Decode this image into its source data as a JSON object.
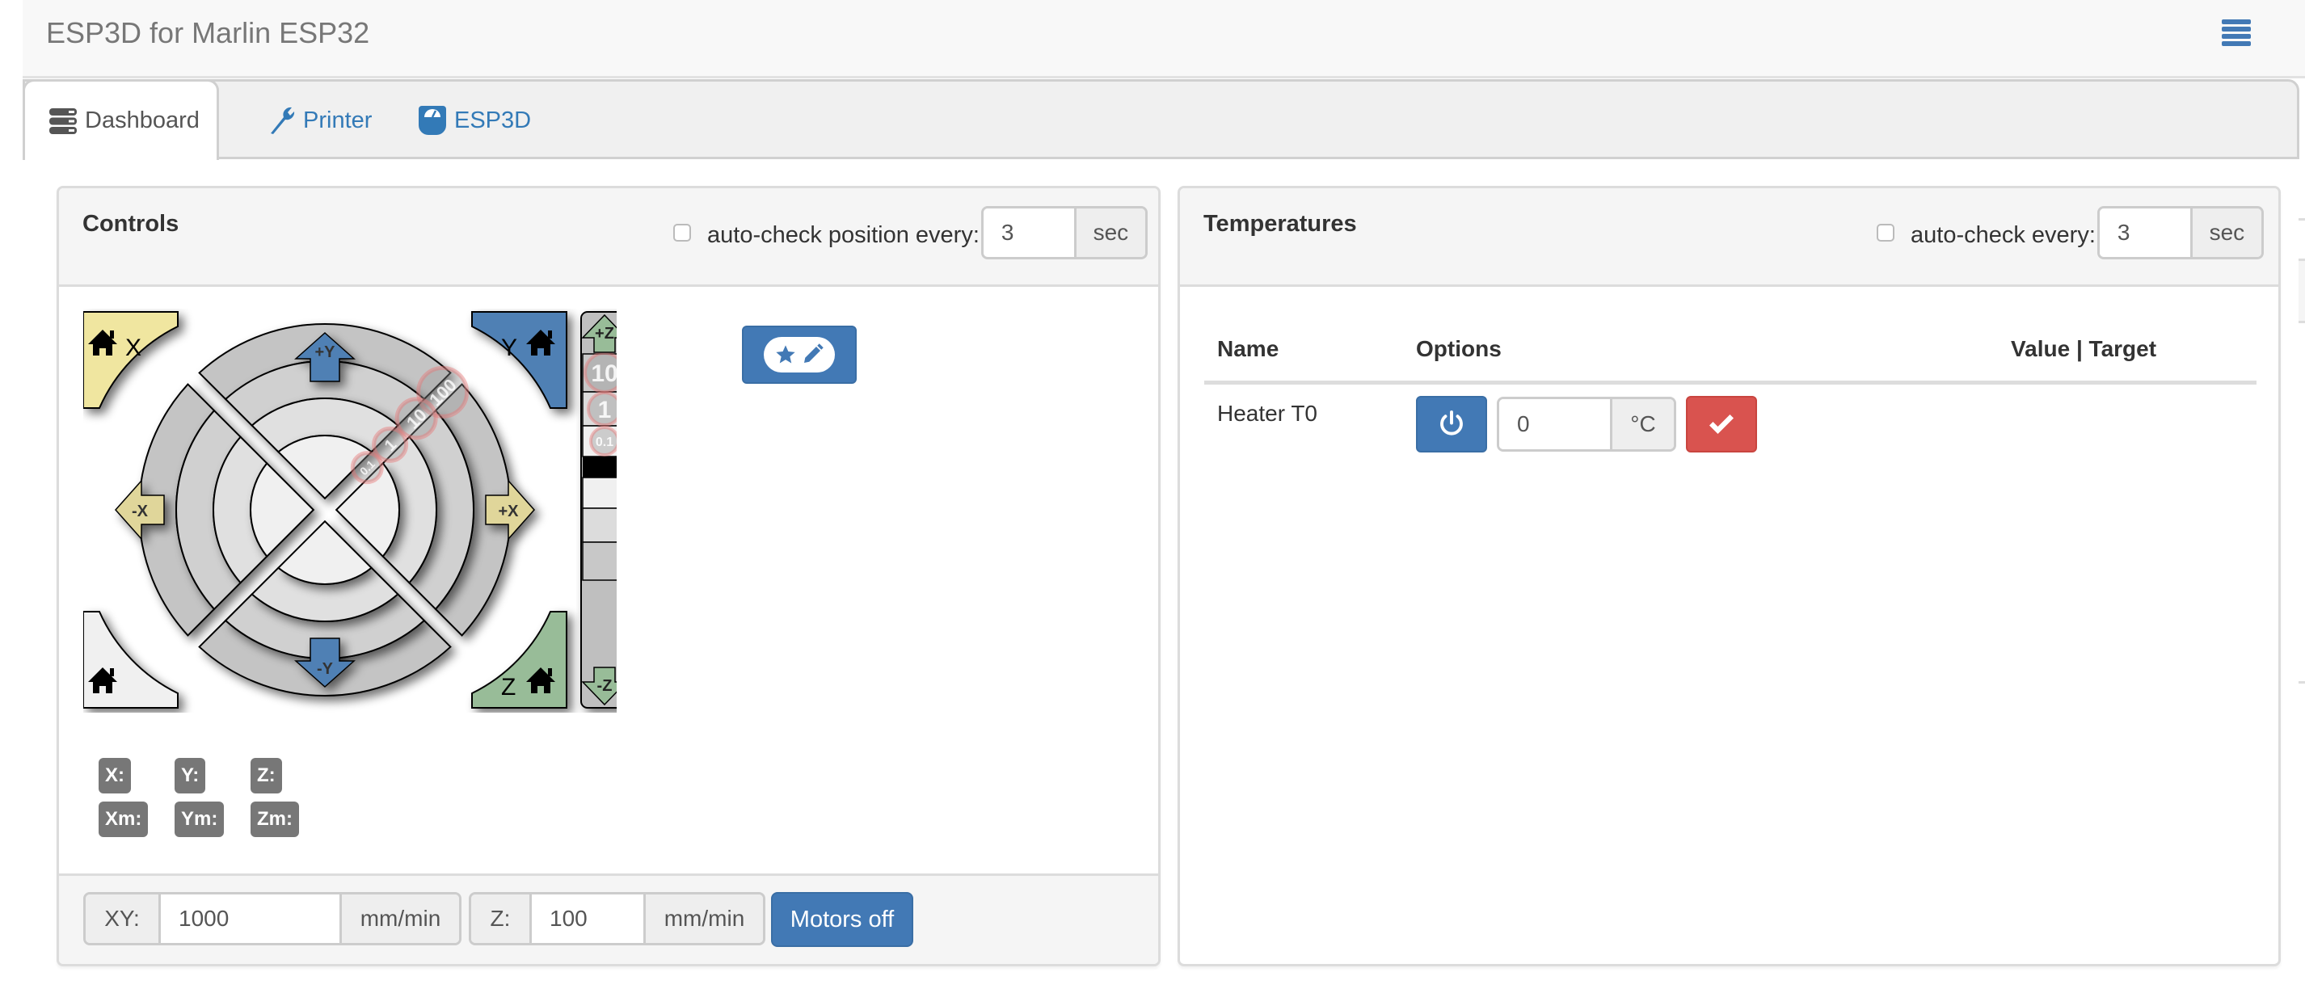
{
  "app": {
    "title": "ESP3D for Marlin ESP32",
    "menu_icon": "hamburger-menu-icon"
  },
  "tabs": [
    {
      "label": "Dashboard",
      "icon": "server-stack-icon",
      "active": true
    },
    {
      "label": "Printer",
      "icon": "wrench-icon",
      "active": false
    },
    {
      "label": "ESP3D",
      "icon": "dashboard-gauge-icon",
      "active": false
    }
  ],
  "controls": {
    "title": "Controls",
    "autocheck_label": "auto-check position every:",
    "autocheck_checked": false,
    "autocheck_value": "3",
    "autocheck_unit": "sec",
    "jog": {
      "corners": {
        "home_x": "X",
        "home_y": "Y",
        "home_z": "Z"
      },
      "arrows": {
        "plus_y": "+Y",
        "minus_y": "-Y",
        "plus_x": "+X",
        "minus_x": "-X",
        "plus_z": "+Z",
        "minus_z": "-Z"
      },
      "xy_steps": [
        "100",
        "10",
        "1",
        "0.1"
      ],
      "z_steps": [
        "10",
        "1",
        "0.1"
      ],
      "colors": {
        "x": "#f0e6a0",
        "y": "#5080b4",
        "z": "#98bc98",
        "all": "#f0f0f0"
      }
    },
    "macro_button_icon": "star-pencil-icon",
    "positions": {
      "x": "X:",
      "y": "Y:",
      "z": "Z:",
      "xm": "Xm:",
      "ym": "Ym:",
      "zm": "Zm:"
    },
    "feed": {
      "xy_label": "XY:",
      "xy_value": "1000",
      "xy_unit": "mm/min",
      "z_label": "Z:",
      "z_value": "100",
      "z_unit": "mm/min",
      "motors_off_label": "Motors off"
    }
  },
  "temperatures": {
    "title": "Temperatures",
    "autocheck_label": "auto-check every:",
    "autocheck_checked": false,
    "autocheck_value": "3",
    "autocheck_unit": "sec",
    "columns": [
      "Name",
      "Options",
      "Value | Target"
    ],
    "rows": [
      {
        "name": "Heater T0",
        "target_input": "0",
        "unit": "°C",
        "value_target": ""
      }
    ]
  },
  "colors": {
    "primary": "#4279b5",
    "danger": "#d9534f",
    "badge": "#777777"
  }
}
